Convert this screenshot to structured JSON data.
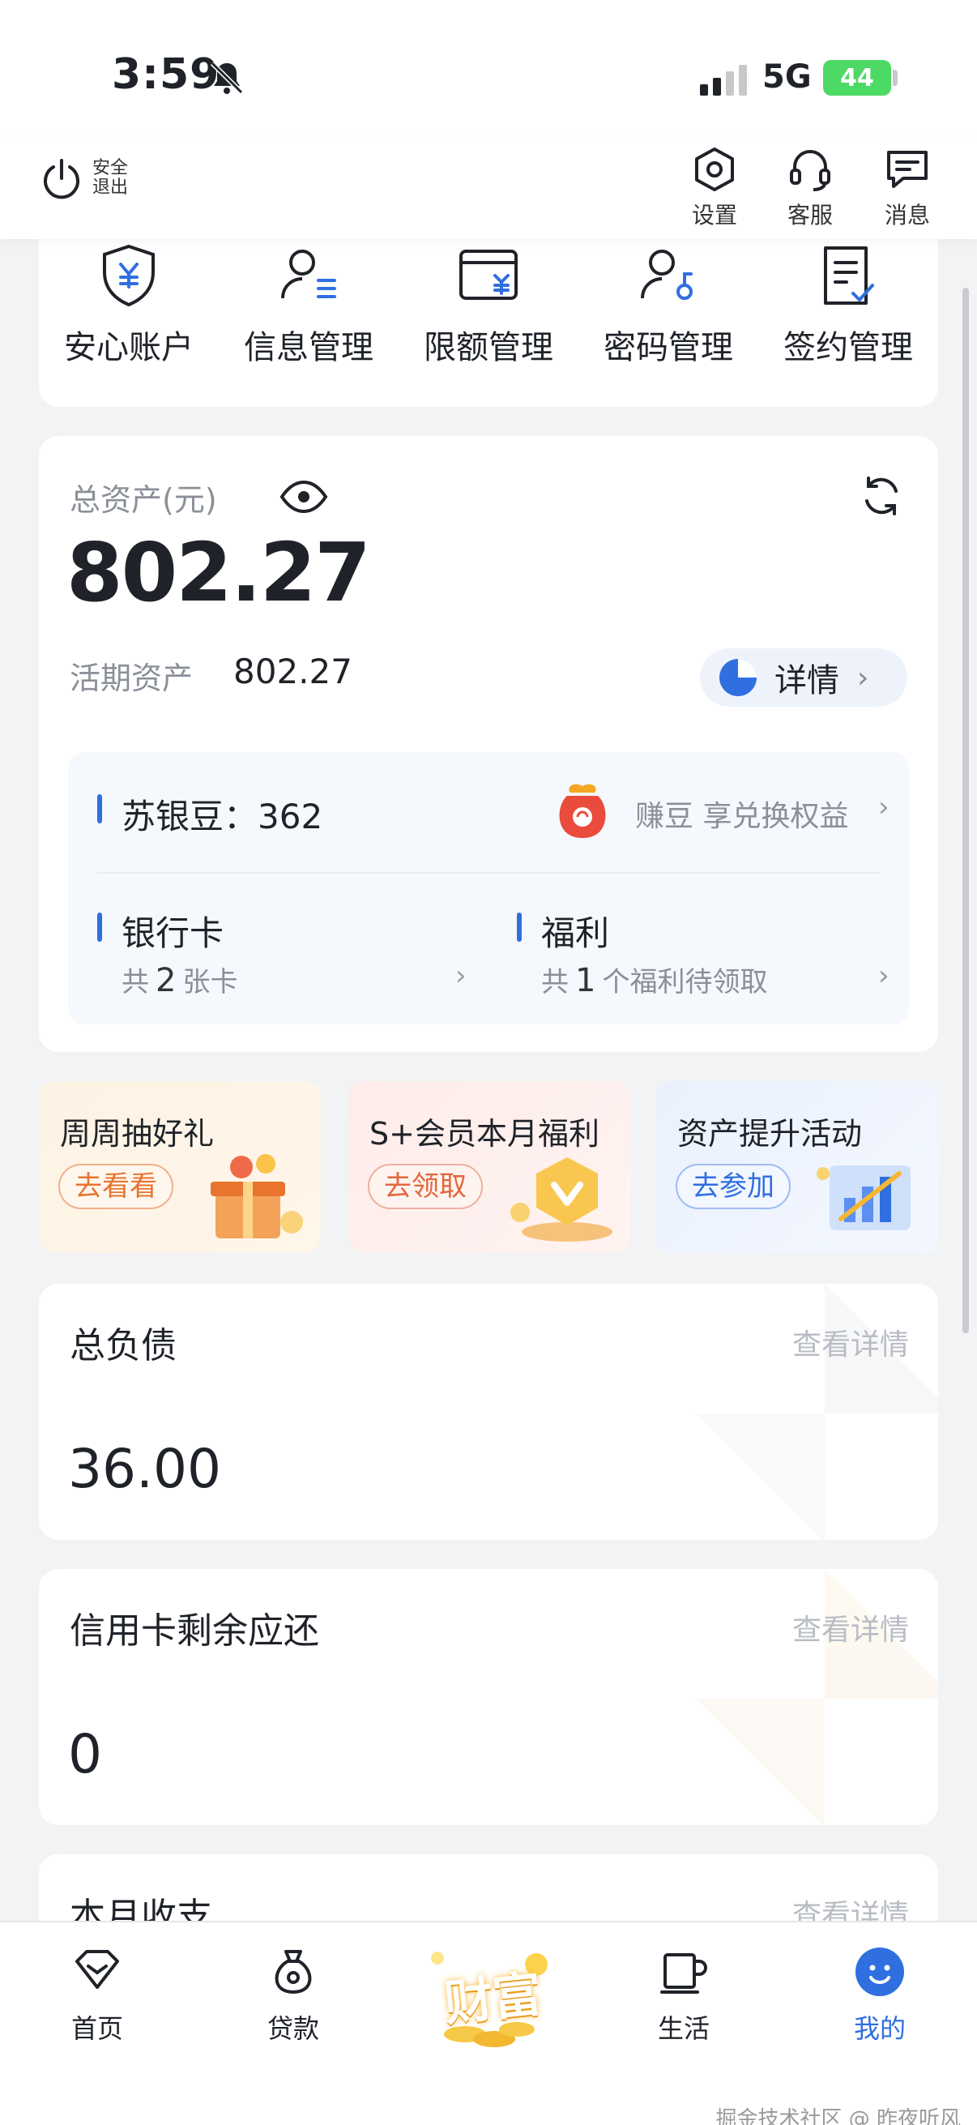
{
  "status_bar": {
    "time": "3:59",
    "network": "5G",
    "battery": "44"
  },
  "header": {
    "logout_label": "安全退出",
    "actions": [
      {
        "label": "设置",
        "icon": "hexagon-settings-icon"
      },
      {
        "label": "客服",
        "icon": "headset-icon"
      },
      {
        "label": "消息",
        "icon": "message-icon"
      }
    ]
  },
  "quick_menu": [
    {
      "label": "安心账户",
      "icon": "shield-yuan-icon"
    },
    {
      "label": "信息管理",
      "icon": "user-list-icon"
    },
    {
      "label": "限额管理",
      "icon": "card-yuan-icon"
    },
    {
      "label": "密码管理",
      "icon": "user-key-icon"
    },
    {
      "label": "签约管理",
      "icon": "doc-check-icon"
    }
  ],
  "assets": {
    "label": "总资产(元)",
    "total": "802.27",
    "current_label": "活期资产",
    "current_value": "802.27",
    "detail_label": "详情"
  },
  "beans": {
    "label": "苏银豆：362",
    "link": "赚豆 享兑换权益"
  },
  "bank_cards": {
    "title": "银行卡",
    "prefix": "共",
    "count": "2",
    "suffix": "张卡"
  },
  "benefits": {
    "title": "福利",
    "prefix": "共",
    "count": "1",
    "suffix": "个福利待领取"
  },
  "promos": [
    {
      "title": "周周抽好礼",
      "button": "去看看",
      "accent": "#e8742e"
    },
    {
      "title": "S+会员本月福利",
      "button": "去领取",
      "accent": "#e0673c"
    },
    {
      "title": "资产提升活动",
      "button": "去参加",
      "accent": "#2f6fe0"
    }
  ],
  "liabilities": {
    "title": "总负债",
    "link": "查看详情",
    "value": "36.00"
  },
  "credit_card": {
    "title": "信用卡剩余应还",
    "link": "查看详情",
    "value": "0"
  },
  "monthly": {
    "title": "本月收支",
    "link": "查看详情"
  },
  "bottom_nav": [
    {
      "label": "首页",
      "icon": "home-icon"
    },
    {
      "label": "贷款",
      "icon": "money-bag-icon"
    },
    {
      "label": "财富",
      "icon": "wealth-coins-icon"
    },
    {
      "label": "生活",
      "icon": "coffee-cup-icon"
    },
    {
      "label": "我的",
      "icon": "smiley-user-icon",
      "active": true
    }
  ],
  "watermark": "掘金技术社区 @ 昨夜听风",
  "colors": {
    "accent_blue": "#2f6fe0",
    "background": "#f2f3f5",
    "battery_green": "#4cd964"
  }
}
